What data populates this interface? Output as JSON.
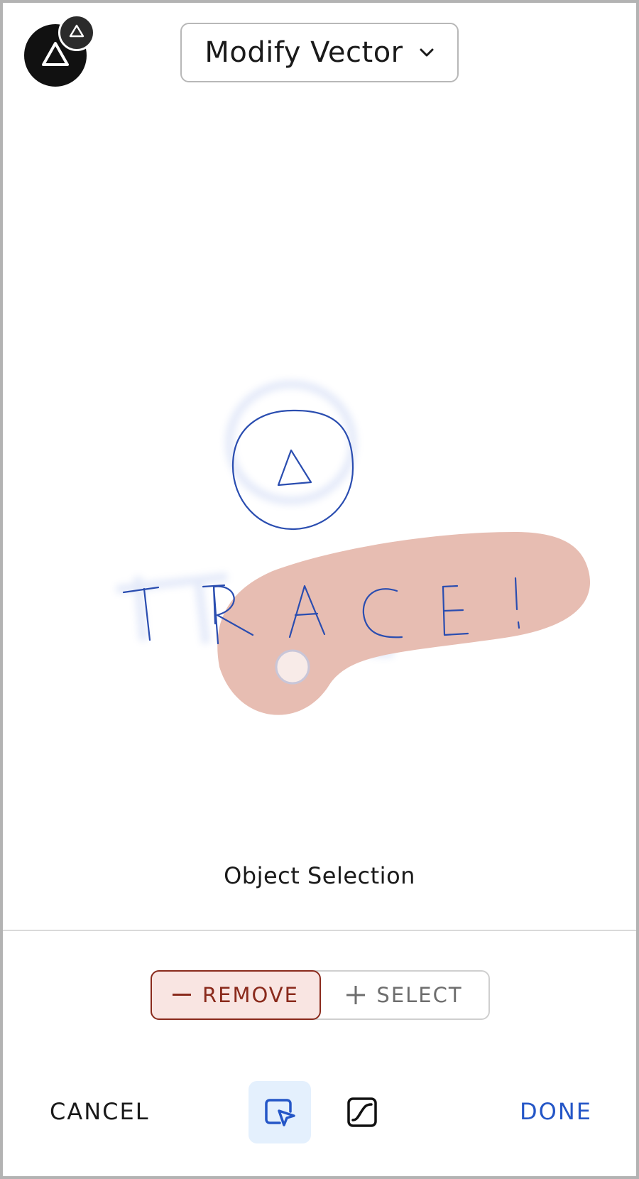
{
  "header": {
    "mode_label": "Modify Vector",
    "app_icon": "triangle-badge-icon",
    "dropdown_icon": "chevron-down-icon"
  },
  "canvas": {
    "drawing_text": "TRACE!",
    "stroke_color": "#2a4db0",
    "mask_color": "#e7bdb2"
  },
  "tool_caption": "Object Selection",
  "mask_mode": {
    "remove_label": "REMOVE",
    "select_label": "SELECT",
    "active": "remove"
  },
  "bottom_bar": {
    "cancel_label": "CANCEL",
    "done_label": "DONE",
    "tools": [
      "object-selection-icon",
      "path-selection-icon"
    ],
    "active_tool": "object-selection"
  },
  "colors": {
    "accent": "#2456c7",
    "remove": "#8a2a1c",
    "remove_bg": "#f9e5e2",
    "active_tool_bg": "#e4f0fd"
  }
}
